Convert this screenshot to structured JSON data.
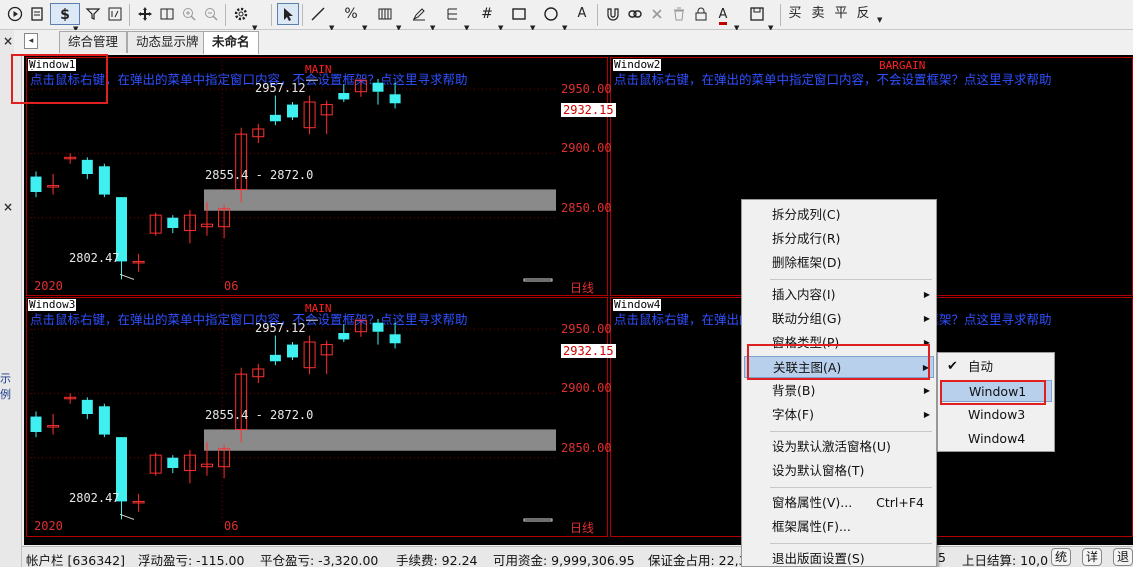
{
  "toolbar": {
    "icons": [
      "play-icon",
      "doc-icon",
      "dollar-icon",
      "filter-icon",
      "number-icon",
      "move-icon",
      "zoom-reset-icon",
      "zoom-in-icon",
      "zoom-out-icon",
      "gear-icon",
      "pointer-icon",
      "line-icon",
      "percent-icon",
      "bars-icon",
      "pen-icon",
      "parallel-icon",
      "grid-icon",
      "rect-icon",
      "ellipse-icon",
      "text-icon",
      "magnet-icon",
      "link-icon",
      "close-icon",
      "delete-icon",
      "lock-icon",
      "color-icon",
      "save-icon"
    ],
    "dollar_label": "$",
    "text_tool": "A",
    "font_color_label": "A",
    "buttons": {
      "buy": "买",
      "sell": "卖",
      "flat": "平",
      "reverse": "反"
    }
  },
  "tabs": [
    {
      "label": "综合管理",
      "active": false
    },
    {
      "label": "动态显示牌",
      "active": false
    },
    {
      "label": "未命名",
      "active": true
    }
  ],
  "left_strip": {
    "close_marks": [
      "×",
      "×"
    ],
    "side_text": "示例"
  },
  "panes": [
    {
      "id": "Window1",
      "tag": "MAIN",
      "hint": "点击鼠标右键，在弹出的菜单中指定窗口内容，不会设置框架？点这里寻求帮助",
      "high_label": "2957.12",
      "low_label": "2802.47",
      "range_label": "2855.4 - 2872.0",
      "price_marker": "2932.15",
      "axis_labels": [
        "2950.00",
        "2900.00",
        "2850.00"
      ],
      "date_labels": [
        "2020",
        "06"
      ],
      "period": "日线"
    },
    {
      "id": "Window2",
      "tag": "BARGAIN",
      "hint": "点击鼠标右键，在弹出的菜单中指定窗口内容，不会设置框架？点这里寻求帮助"
    },
    {
      "id": "Window3",
      "tag": "MAIN",
      "hint": "点击鼠标右键，在弹出的菜单中指定窗口内容，不会设置框架？点这里寻求帮助",
      "high_label": "2957.12",
      "low_label": "2802.47",
      "range_label": "2855.4 - 2872.0",
      "price_marker": "2932.15",
      "axis_labels": [
        "2950.00",
        "2900.00",
        "2850.00"
      ],
      "date_labels": [
        "2020",
        "06"
      ],
      "period": "日线"
    },
    {
      "id": "Window4",
      "tag": "",
      "hint": "点击鼠标右键，在弹出的菜单中指定窗口内容，不会设置框架？点这里寻求帮助"
    }
  ],
  "chart_data": {
    "type": "candlestick",
    "ylim": [
      2800,
      2975
    ],
    "yticks": [
      2850,
      2900,
      2950
    ],
    "candles": [
      {
        "o": 2870,
        "c": 2882,
        "h": 2886,
        "l": 2866,
        "up": false
      },
      {
        "o": 2875,
        "c": 2875,
        "h": 2884,
        "l": 2868,
        "up": true
      },
      {
        "o": 2897,
        "c": 2897,
        "h": 2900,
        "l": 2892,
        "up": true
      },
      {
        "o": 2895,
        "c": 2884,
        "h": 2897,
        "l": 2880,
        "up": false
      },
      {
        "o": 2890,
        "c": 2868,
        "h": 2892,
        "l": 2866,
        "up": false
      },
      {
        "o": 2866,
        "c": 2816,
        "h": 2866,
        "l": 2802,
        "up": false
      },
      {
        "o": 2816,
        "c": 2816,
        "h": 2822,
        "l": 2808,
        "up": true
      },
      {
        "o": 2838,
        "c": 2852,
        "h": 2854,
        "l": 2836,
        "up": true
      },
      {
        "o": 2850,
        "c": 2842,
        "h": 2852,
        "l": 2838,
        "up": false
      },
      {
        "o": 2840,
        "c": 2852,
        "h": 2856,
        "l": 2830,
        "up": true
      },
      {
        "o": 2845,
        "c": 2843,
        "h": 2862,
        "l": 2836,
        "up": true
      },
      {
        "o": 2843,
        "c": 2857,
        "h": 2860,
        "l": 2834,
        "up": true
      },
      {
        "o": 2872,
        "c": 2915,
        "h": 2920,
        "l": 2862,
        "up": true
      },
      {
        "o": 2913,
        "c": 2919,
        "h": 2923,
        "l": 2908,
        "up": true
      },
      {
        "o": 2930,
        "c": 2925,
        "h": 2945,
        "l": 2922,
        "up": false
      },
      {
        "o": 2938,
        "c": 2928,
        "h": 2940,
        "l": 2926,
        "up": false
      },
      {
        "o": 2920,
        "c": 2940,
        "h": 2945,
        "l": 2915,
        "up": true
      },
      {
        "o": 2930,
        "c": 2938,
        "h": 2941,
        "l": 2915,
        "up": true
      },
      {
        "o": 2942,
        "c": 2947,
        "h": 2954,
        "l": 2940,
        "up": false
      },
      {
        "o": 2948,
        "c": 2957,
        "h": 2957,
        "l": 2944,
        "up": true
      },
      {
        "o": 2955,
        "c": 2948,
        "h": 2958,
        "l": 2938,
        "up": false
      },
      {
        "o": 2946,
        "c": 2939,
        "h": 2955,
        "l": 2935,
        "up": false
      }
    ],
    "volume_band": [
      2855.4,
      2872.0
    ]
  },
  "context_menu": {
    "items": [
      {
        "label": "拆分成列(C)",
        "arrow": false
      },
      {
        "label": "拆分成行(R)",
        "arrow": false
      },
      {
        "label": "删除框架(D)",
        "arrow": false
      },
      {
        "sep": true
      },
      {
        "label": "插入内容(I)",
        "arrow": true
      },
      {
        "label": "联动分组(G)",
        "arrow": true
      },
      {
        "label": "窗格类型(P)",
        "arrow": true
      },
      {
        "label": "关联主图(A)",
        "arrow": true,
        "highlight": true
      },
      {
        "label": "背景(B)",
        "arrow": true
      },
      {
        "label": "字体(F)",
        "arrow": true
      },
      {
        "sep": true
      },
      {
        "label": "设为默认激活窗格(U)",
        "arrow": false
      },
      {
        "label": "设为默认窗格(T)",
        "arrow": false
      },
      {
        "sep": true
      },
      {
        "label": "窗格属性(V)...",
        "shortcut": "Ctrl+F4",
        "arrow": false
      },
      {
        "label": "框架属性(F)...",
        "arrow": false
      },
      {
        "sep": true
      },
      {
        "label": "退出版面设置(S)",
        "arrow": false
      }
    ]
  },
  "submenu": {
    "items": [
      {
        "label": "自动",
        "checked": true
      },
      {
        "label": "Window1",
        "highlight": true
      },
      {
        "label": "Window3"
      },
      {
        "label": "Window4"
      }
    ]
  },
  "statusbar": {
    "account": "帐户栏 [636342]",
    "float_pl": "浮动盈亏: -115.00",
    "close_pl": "平仓盈亏: -3,320.00",
    "fee": "手续费: 92.24",
    "available": "可用资金: 9,999,306.95",
    "margin": "保证金占用: 22,3",
    "tail": "5",
    "last_settle": "上日结算: 10,0",
    "btn_stat": "统",
    "btn_detail": "详",
    "btn_back": "退"
  },
  "colors": {
    "up": "#ff3030",
    "down": "#40f0f0",
    "grid": "#7a0000",
    "hint": "#3050ff",
    "accent_red": "#e02020"
  }
}
